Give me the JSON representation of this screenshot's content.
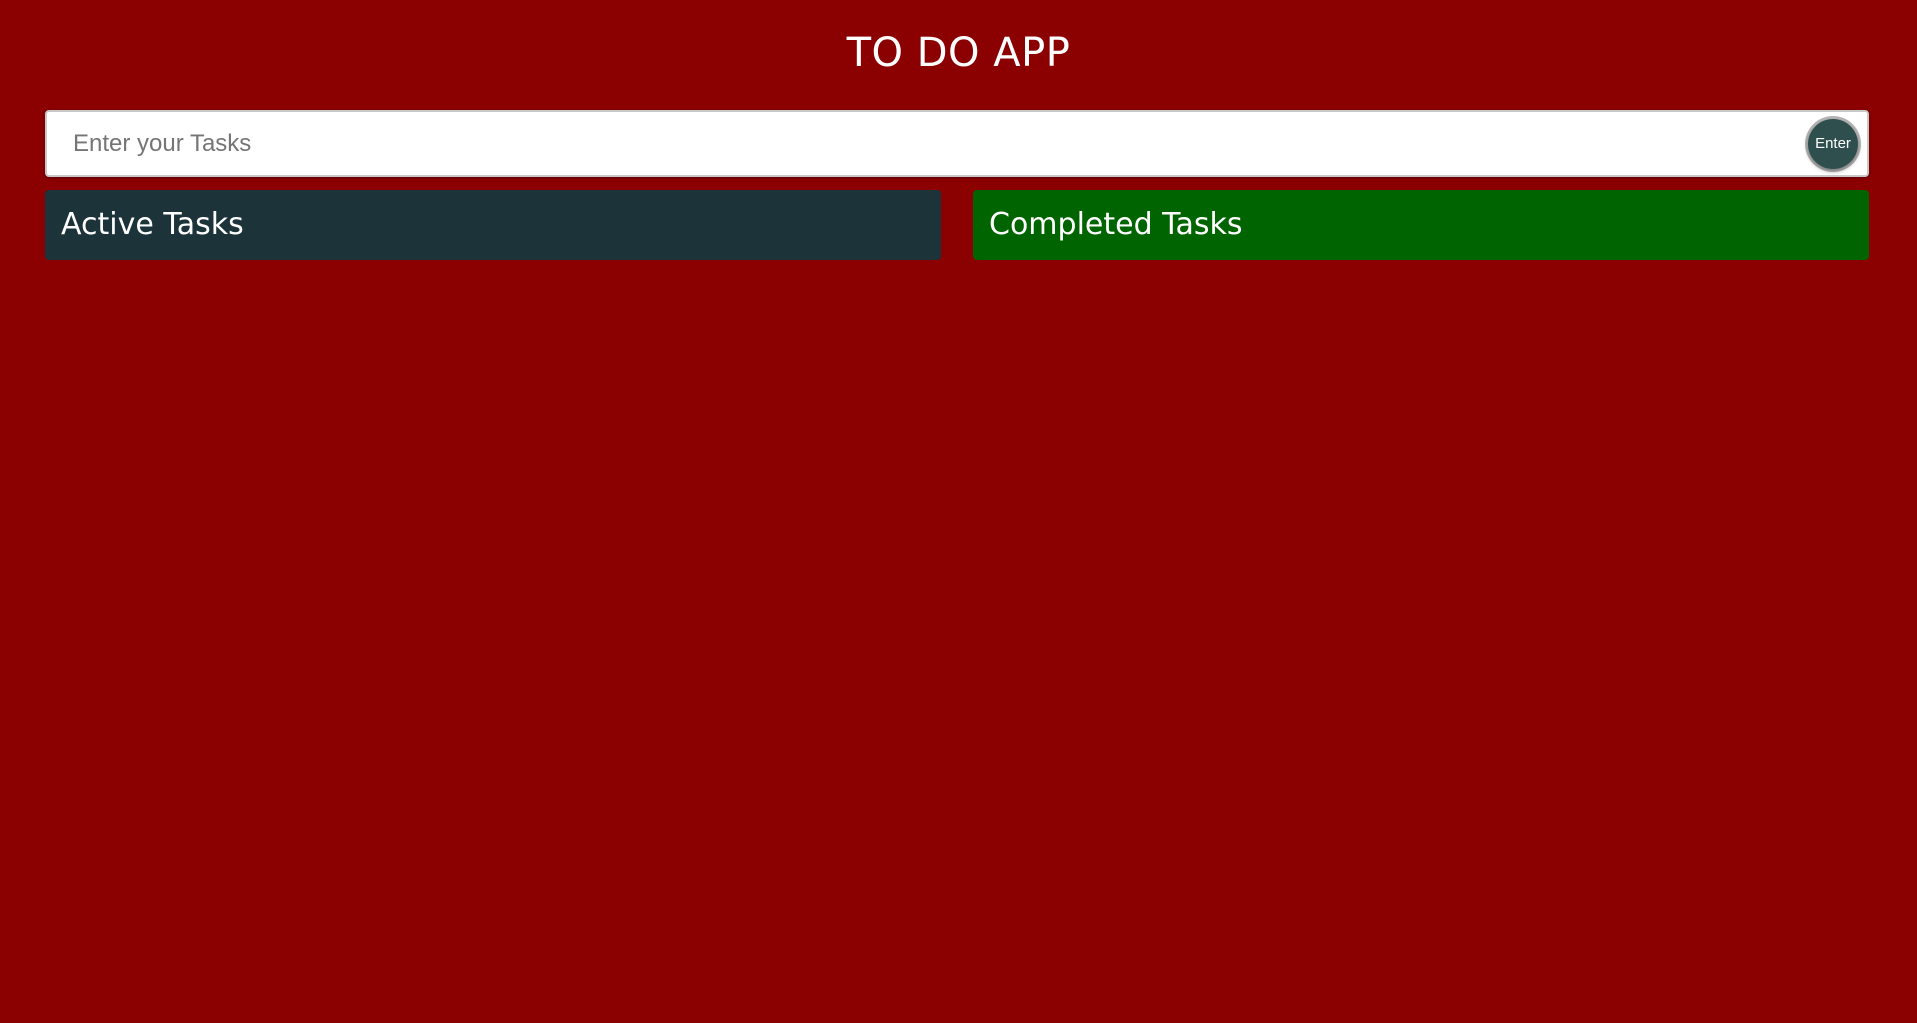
{
  "app": {
    "title": "TO DO APP"
  },
  "task_entry": {
    "placeholder": "Enter your Tasks",
    "value": "",
    "enter_label": "Enter"
  },
  "panels": {
    "active": {
      "title": "Active Tasks",
      "items": []
    },
    "completed": {
      "title": "Completed Tasks",
      "items": []
    }
  },
  "colors": {
    "background": "#8b0000",
    "active_panel": "#1c3339",
    "completed_panel": "#006400",
    "enter_button": "#2f4f4f"
  }
}
